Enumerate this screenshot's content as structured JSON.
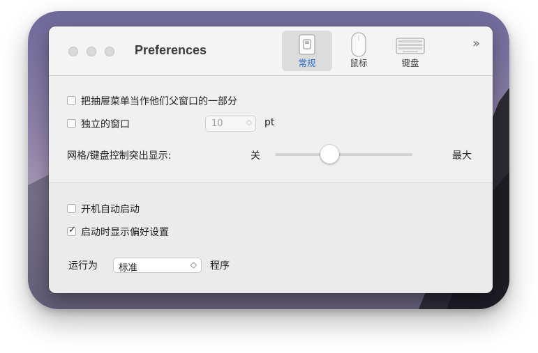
{
  "window": {
    "title": "Preferences",
    "more_label": "»"
  },
  "toolbar": {
    "items": [
      {
        "label": "常规",
        "icon": "switch-icon",
        "active": true
      },
      {
        "label": "鼠标",
        "icon": "mouse-icon",
        "active": false
      },
      {
        "label": "键盘",
        "icon": "keyboard-icon",
        "active": false
      }
    ]
  },
  "general": {
    "drawer_checkbox": {
      "label": "把抽屉菜单当作他们父窗口的一部分",
      "checked": false
    },
    "separate_window_checkbox": {
      "label": "独立的窗口",
      "checked": false
    },
    "stepper": {
      "value": "10",
      "unit": "pt",
      "enabled": false
    },
    "grid_label": "网格/键盘控制突出显示:",
    "slider": {
      "min_label": "关",
      "max_label": "最大",
      "value_fraction": 0.4
    }
  },
  "startup": {
    "launch_checkbox": {
      "label": "开机自动启动",
      "checked": false
    },
    "show_prefs_checkbox": {
      "label": "启动时显示偏好设置",
      "checked": true
    },
    "run_as_label": "运行为",
    "run_as_value": "标准",
    "program_label": "程序"
  },
  "colors": {
    "accent": "#2a6fd6",
    "window_bg": "#ececec"
  }
}
